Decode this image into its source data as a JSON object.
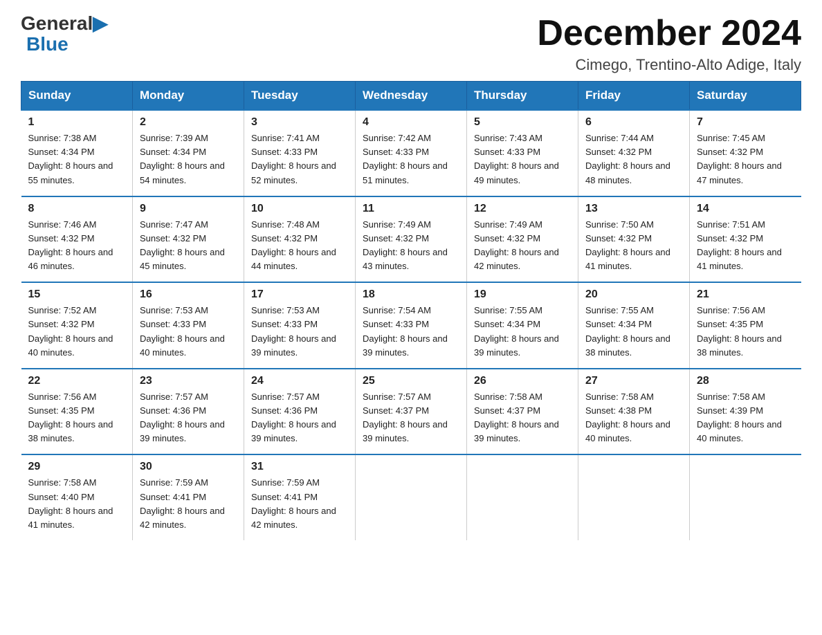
{
  "logo": {
    "general": "General",
    "blue": "Blue",
    "triangle": true
  },
  "title": "December 2024",
  "location": "Cimego, Trentino-Alto Adige, Italy",
  "days_of_week": [
    "Sunday",
    "Monday",
    "Tuesday",
    "Wednesday",
    "Thursday",
    "Friday",
    "Saturday"
  ],
  "weeks": [
    [
      {
        "day": "1",
        "sunrise": "7:38 AM",
        "sunset": "4:34 PM",
        "daylight": "8 hours and 55 minutes."
      },
      {
        "day": "2",
        "sunrise": "7:39 AM",
        "sunset": "4:34 PM",
        "daylight": "8 hours and 54 minutes."
      },
      {
        "day": "3",
        "sunrise": "7:41 AM",
        "sunset": "4:33 PM",
        "daylight": "8 hours and 52 minutes."
      },
      {
        "day": "4",
        "sunrise": "7:42 AM",
        "sunset": "4:33 PM",
        "daylight": "8 hours and 51 minutes."
      },
      {
        "day": "5",
        "sunrise": "7:43 AM",
        "sunset": "4:33 PM",
        "daylight": "8 hours and 49 minutes."
      },
      {
        "day": "6",
        "sunrise": "7:44 AM",
        "sunset": "4:32 PM",
        "daylight": "8 hours and 48 minutes."
      },
      {
        "day": "7",
        "sunrise": "7:45 AM",
        "sunset": "4:32 PM",
        "daylight": "8 hours and 47 minutes."
      }
    ],
    [
      {
        "day": "8",
        "sunrise": "7:46 AM",
        "sunset": "4:32 PM",
        "daylight": "8 hours and 46 minutes."
      },
      {
        "day": "9",
        "sunrise": "7:47 AM",
        "sunset": "4:32 PM",
        "daylight": "8 hours and 45 minutes."
      },
      {
        "day": "10",
        "sunrise": "7:48 AM",
        "sunset": "4:32 PM",
        "daylight": "8 hours and 44 minutes."
      },
      {
        "day": "11",
        "sunrise": "7:49 AM",
        "sunset": "4:32 PM",
        "daylight": "8 hours and 43 minutes."
      },
      {
        "day": "12",
        "sunrise": "7:49 AM",
        "sunset": "4:32 PM",
        "daylight": "8 hours and 42 minutes."
      },
      {
        "day": "13",
        "sunrise": "7:50 AM",
        "sunset": "4:32 PM",
        "daylight": "8 hours and 41 minutes."
      },
      {
        "day": "14",
        "sunrise": "7:51 AM",
        "sunset": "4:32 PM",
        "daylight": "8 hours and 41 minutes."
      }
    ],
    [
      {
        "day": "15",
        "sunrise": "7:52 AM",
        "sunset": "4:32 PM",
        "daylight": "8 hours and 40 minutes."
      },
      {
        "day": "16",
        "sunrise": "7:53 AM",
        "sunset": "4:33 PM",
        "daylight": "8 hours and 40 minutes."
      },
      {
        "day": "17",
        "sunrise": "7:53 AM",
        "sunset": "4:33 PM",
        "daylight": "8 hours and 39 minutes."
      },
      {
        "day": "18",
        "sunrise": "7:54 AM",
        "sunset": "4:33 PM",
        "daylight": "8 hours and 39 minutes."
      },
      {
        "day": "19",
        "sunrise": "7:55 AM",
        "sunset": "4:34 PM",
        "daylight": "8 hours and 39 minutes."
      },
      {
        "day": "20",
        "sunrise": "7:55 AM",
        "sunset": "4:34 PM",
        "daylight": "8 hours and 38 minutes."
      },
      {
        "day": "21",
        "sunrise": "7:56 AM",
        "sunset": "4:35 PM",
        "daylight": "8 hours and 38 minutes."
      }
    ],
    [
      {
        "day": "22",
        "sunrise": "7:56 AM",
        "sunset": "4:35 PM",
        "daylight": "8 hours and 38 minutes."
      },
      {
        "day": "23",
        "sunrise": "7:57 AM",
        "sunset": "4:36 PM",
        "daylight": "8 hours and 39 minutes."
      },
      {
        "day": "24",
        "sunrise": "7:57 AM",
        "sunset": "4:36 PM",
        "daylight": "8 hours and 39 minutes."
      },
      {
        "day": "25",
        "sunrise": "7:57 AM",
        "sunset": "4:37 PM",
        "daylight": "8 hours and 39 minutes."
      },
      {
        "day": "26",
        "sunrise": "7:58 AM",
        "sunset": "4:37 PM",
        "daylight": "8 hours and 39 minutes."
      },
      {
        "day": "27",
        "sunrise": "7:58 AM",
        "sunset": "4:38 PM",
        "daylight": "8 hours and 40 minutes."
      },
      {
        "day": "28",
        "sunrise": "7:58 AM",
        "sunset": "4:39 PM",
        "daylight": "8 hours and 40 minutes."
      }
    ],
    [
      {
        "day": "29",
        "sunrise": "7:58 AM",
        "sunset": "4:40 PM",
        "daylight": "8 hours and 41 minutes."
      },
      {
        "day": "30",
        "sunrise": "7:59 AM",
        "sunset": "4:41 PM",
        "daylight": "8 hours and 42 minutes."
      },
      {
        "day": "31",
        "sunrise": "7:59 AM",
        "sunset": "4:41 PM",
        "daylight": "8 hours and 42 minutes."
      },
      null,
      null,
      null,
      null
    ]
  ],
  "colors": {
    "header_bg": "#2176b8",
    "header_text": "#ffffff",
    "border": "#2176b8"
  }
}
